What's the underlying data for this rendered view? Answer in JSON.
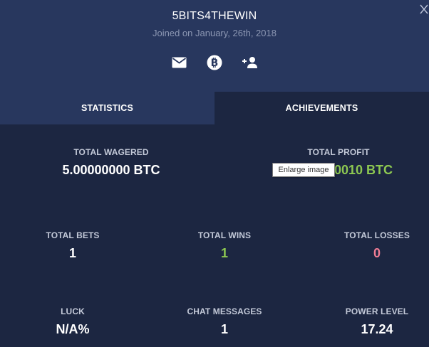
{
  "profile": {
    "username": "5BITS4THEWIN",
    "joined": "Joined on January, 26th, 2018"
  },
  "icons": {
    "message": "mail-icon",
    "tip": "bitcoin-icon",
    "add_friend": "add-user-icon",
    "close": "close-icon"
  },
  "tabs": [
    {
      "label": "STATISTICS",
      "active": true
    },
    {
      "label": "ACHIEVEMENTS",
      "active": false
    }
  ],
  "stats": {
    "total_wagered": {
      "label": "TOTAL WAGERED",
      "value": "5.00000000 BTC"
    },
    "total_profit": {
      "label": "TOTAL PROFIT",
      "value": "0010 BTC"
    },
    "total_bets": {
      "label": "TOTAL BETS",
      "value": "1"
    },
    "total_wins": {
      "label": "TOTAL WINS",
      "value": "1"
    },
    "total_losses": {
      "label": "TOTAL LOSSES",
      "value": "0"
    },
    "luck": {
      "label": "LUCK",
      "value": "N/A%"
    },
    "chat_messages": {
      "label": "CHAT MESSAGES",
      "value": "1"
    },
    "power_level": {
      "label": "POWER LEVEL",
      "value": "17.24"
    }
  },
  "tooltip": {
    "text": "Enlarge image"
  },
  "colors": {
    "header_bg": "#28375e",
    "body_bg": "#1c2641",
    "positive": "#8dc851",
    "negative": "#f07c94"
  }
}
